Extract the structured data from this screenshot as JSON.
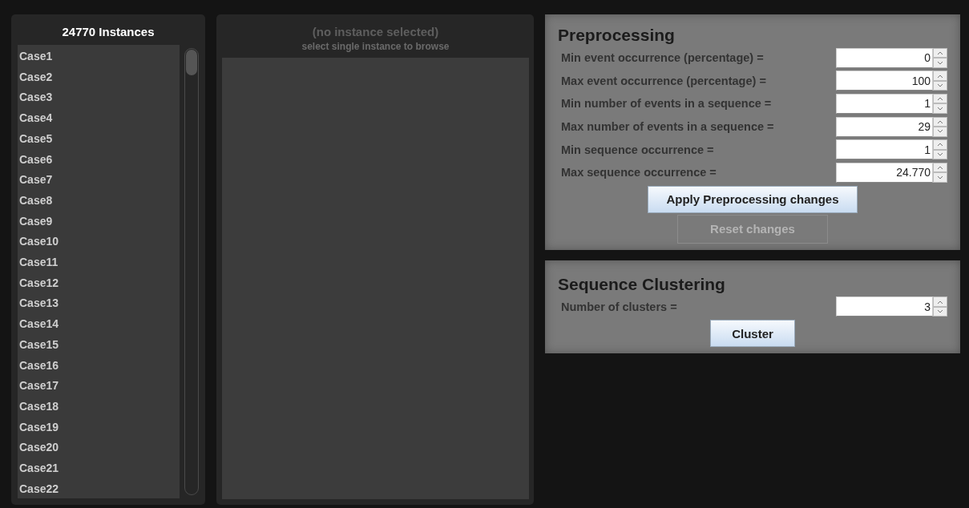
{
  "instances": {
    "title": "24770 Instances",
    "items": [
      "Case1",
      "Case2",
      "Case3",
      "Case4",
      "Case5",
      "Case6",
      "Case7",
      "Case8",
      "Case9",
      "Case10",
      "Case11",
      "Case12",
      "Case13",
      "Case14",
      "Case15",
      "Case16",
      "Case17",
      "Case18",
      "Case19",
      "Case20",
      "Case21",
      "Case22"
    ]
  },
  "browser": {
    "title": "(no instance selected)",
    "subtitle": "select single instance to browse"
  },
  "preprocessing": {
    "title": "Preprocessing",
    "fields": [
      {
        "label": "Min event occurrence (percentage) =",
        "value": "0"
      },
      {
        "label": "Max event occurrence (percentage) =",
        "value": "100"
      },
      {
        "label": "Min number of events in a sequence =",
        "value": "1"
      },
      {
        "label": "Max number of events in a sequence =",
        "value": "29"
      },
      {
        "label": "Min sequence occurrence =",
        "value": "1"
      },
      {
        "label": "Max sequence occurrence =",
        "value": "24.770"
      }
    ],
    "buttons": [
      {
        "label": "Apply Preprocessing changes",
        "disabled": false
      },
      {
        "label": "Reset changes",
        "disabled": true
      }
    ]
  },
  "clustering": {
    "title": "Sequence Clustering",
    "fields": [
      {
        "label": "Number of clusters =",
        "value": "3"
      }
    ],
    "buttons": [
      {
        "label": "Cluster",
        "disabled": false
      }
    ]
  }
}
